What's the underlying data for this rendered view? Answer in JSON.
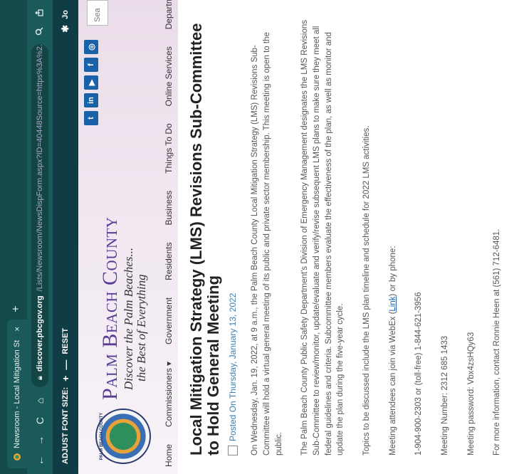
{
  "browser": {
    "tab_title": "Newsroom - Local Mitigation St",
    "tab_close": "×",
    "new_tab": "+",
    "nav": {
      "back": "←",
      "forward": "→",
      "reload": "C",
      "home": "⌂"
    },
    "url_host": "discover.pbcgov.org",
    "url_rest": "/Lists/Newsroom/NewsDispForm.aspx?ID=40448Source=https%3A%2...",
    "icons": {
      "zoom": "search-icon",
      "share": "share-icon"
    }
  },
  "accessibility": {
    "label": "ADJUST FONT SIZE:",
    "increase": "+",
    "decrease": "—",
    "reset": "RESET",
    "user_partial": "Jo"
  },
  "site": {
    "brand_name": "Palm Beach County",
    "tagline_1": "Discover the Palm Beaches...",
    "tagline_2": "the Best of Everything",
    "seal_text": "PALM BEACH COUNTY",
    "search_placeholder": "Sea",
    "social": [
      "t",
      "in",
      "▶",
      "f",
      "◎"
    ],
    "nav": [
      "Home",
      "Commissioners ▾",
      "Government",
      "Residents",
      "Business",
      "Things To Do",
      "Online Services",
      "Departments"
    ]
  },
  "article": {
    "title": "Local Mitigation Strategy (LMS) Revisions Sub-Committee to Hold General Meeting",
    "posted": "Posted On Thursday, January 13, 2022",
    "p1": "On Wednesday, Jan. 19, 2022, at 9 a.m., the Palm Beach County Local Mitigation Strategy (LMS) Revisions Sub-Committee will hold a virtual general meeting of its public and private sector membership. This meeting is open to the public.",
    "p2": "The Palm Beach County Public Safety Department's Division of Emergency Management designates the LMS Revisions Sub-Committee to review/monitor, update/evaluate and verify/revise subsequent LMS plans to make sure they meet all federal guidelines and criteria. Subcommittee members evaluate the effectiveness of the plan, as well as monitor and update the plan during the five-year cycle.",
    "p3": "Topics to be discussed include the LMS plan timeline and schedule for 2022 LMS activities.",
    "p4_before": "Meeting attendees can join via WebEx (",
    "p4_link": "Link",
    "p4_after": ") or by phone:",
    "p5": "1-904-900-2303 or (toll-free) 1-844-621-3956",
    "p6": "Meeting Number: 2312 685 1433",
    "p7": "Meeting password: Vbx4zsHQy63",
    "p8": "For more information, contact Ronnie Heen at (561) 712-6481."
  }
}
